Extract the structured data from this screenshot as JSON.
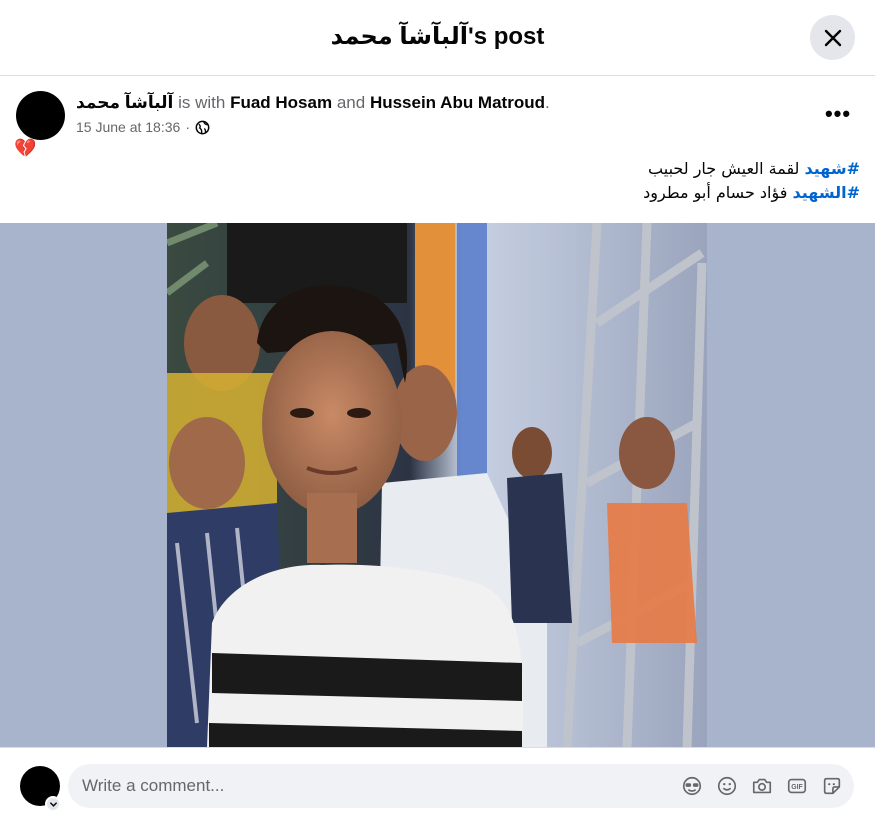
{
  "header": {
    "title": "آلبآشآ محمد's post",
    "close_icon": "close-icon"
  },
  "post": {
    "author": "آلبآشآ محمد",
    "with_text": "is with",
    "tag_1": "Fuad Hosam",
    "and_text": "and",
    "tag_2": "Hussein Abu Matroud",
    "period": ".",
    "date": "15 June at 18:36",
    "separator": "·",
    "audience_icon": "globe-icon",
    "badge_icon": "broken-heart-icon",
    "badge_glyph": "💔",
    "more_icon": "more-options-icon",
    "more_glyph": "•••",
    "line1_hashtag": "#شهيد",
    "line1_text": " لقمة العيش جار لحبيب",
    "line2_hashtag": "#الشهيد",
    "line2_text": " فؤاد حسام أبو مطرود"
  },
  "photo": {
    "subject": "young man in white striped t-shirt",
    "colors": {
      "background": "#a8b4cc",
      "shirt": "#f2f2f2",
      "stripe": "#1a1a1a"
    }
  },
  "comment": {
    "placeholder": "Write a comment...",
    "icons": [
      "avatar-sticker-icon",
      "emoji-icon",
      "camera-icon",
      "gif-icon",
      "sticker-icon"
    ],
    "gif_label": "GIF"
  },
  "colors": {
    "link": "#0064d1",
    "muted": "#65676b",
    "input_bg": "#f0f2f5",
    "button_bg": "#e4e6eb"
  }
}
